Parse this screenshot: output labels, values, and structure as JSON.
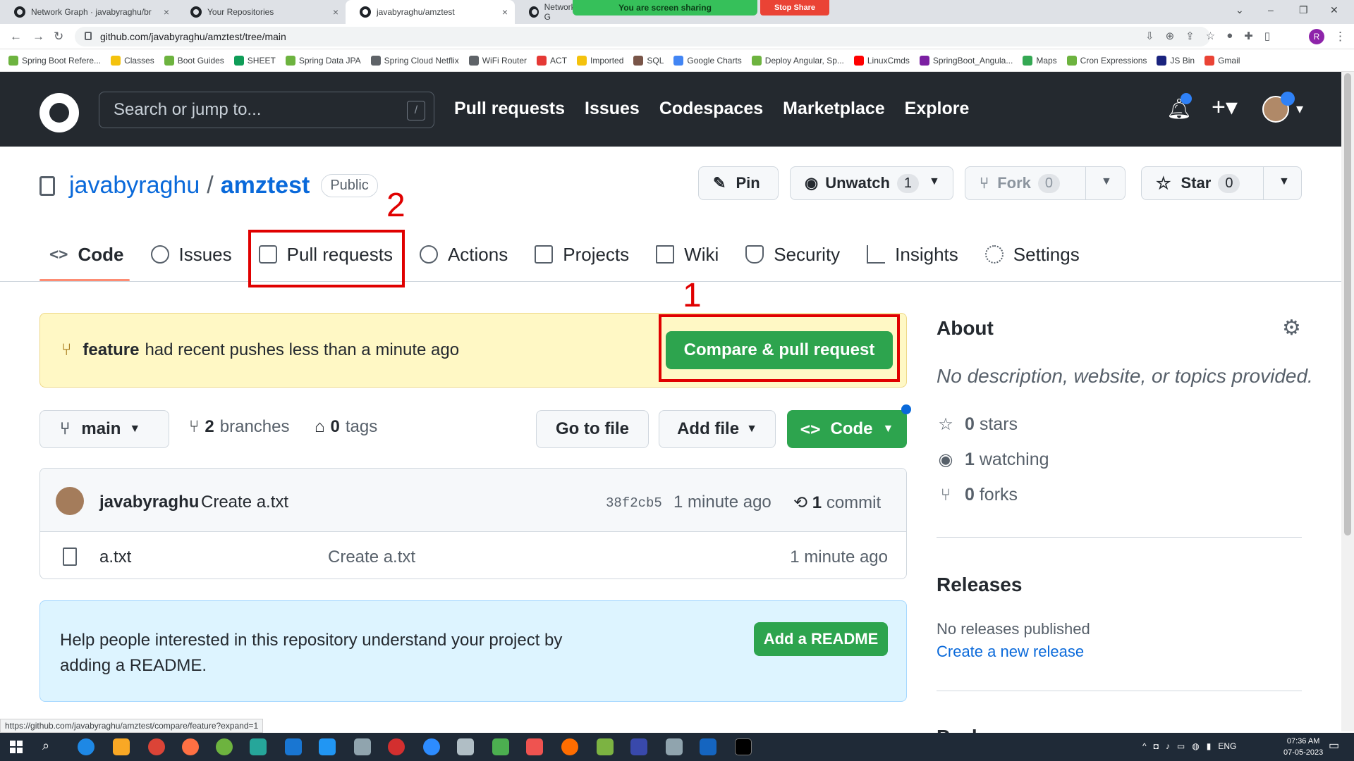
{
  "browser": {
    "tabs": [
      {
        "title": "Network Graph · javabyraghu/br",
        "close": "×"
      },
      {
        "title": "Your Repositories",
        "close": "×"
      },
      {
        "title": "javabyraghu/amztest",
        "close": "×"
      },
      {
        "title": "Network G",
        "close": ""
      }
    ],
    "share_text": "You are screen sharing",
    "stop_share": "Stop Share",
    "url": "github.com/javabyraghu/amztest/tree/main",
    "profile_initial": "R",
    "bookmarks": [
      "Spring Boot Refere...",
      "Classes",
      "Boot Guides",
      "SHEET",
      "Spring Data JPA",
      "Spring Cloud Netflix",
      "WiFi Router",
      "ACT",
      "Imported",
      "SQL",
      "Google Charts",
      "Deploy Angular, Sp...",
      "LinuxCmds",
      "SpringBoot_Angula...",
      "Maps",
      "Cron Expressions",
      "JS Bin",
      "Gmail"
    ],
    "status_url": "https://github.com/javabyraghu/amztest/compare/feature?expand=1"
  },
  "header": {
    "search_placeholder": "Search or jump to...",
    "slash": "/",
    "nav": [
      "Pull requests",
      "Issues",
      "Codespaces",
      "Marketplace",
      "Explore"
    ]
  },
  "repo": {
    "owner": "javabyraghu",
    "separator": "/",
    "name": "amztest",
    "visibility": "Public",
    "pin": "Pin",
    "unwatch": "Unwatch",
    "watch_count": "1",
    "fork": "Fork",
    "fork_count": "0",
    "star": "Star",
    "star_count": "0"
  },
  "tabs": [
    {
      "label": "Code"
    },
    {
      "label": "Issues"
    },
    {
      "label": "Pull requests"
    },
    {
      "label": "Actions"
    },
    {
      "label": "Projects"
    },
    {
      "label": "Wiki"
    },
    {
      "label": "Security"
    },
    {
      "label": "Insights"
    },
    {
      "label": "Settings"
    }
  ],
  "annotations": {
    "one": "1",
    "two": "2"
  },
  "banner": {
    "branch": "feature",
    "text": "had recent pushes less than a minute ago",
    "button": "Compare & pull request"
  },
  "filenav": {
    "branch": "main",
    "branches_count": "2",
    "branches_label": "branches",
    "tags_count": "0",
    "tags_label": "tags",
    "go_to_file": "Go to file",
    "add_file": "Add file",
    "code": "Code"
  },
  "commit": {
    "author": "javabyraghu",
    "message": "Create a.txt",
    "sha": "38f2cb5",
    "time": "1 minute ago",
    "count": "1",
    "count_label": "commit"
  },
  "files": [
    {
      "name": "a.txt",
      "message": "Create a.txt",
      "age": "1 minute ago"
    }
  ],
  "readme": {
    "text": "Help people interested in this repository understand your project by adding a README.",
    "button": "Add a README"
  },
  "about": {
    "title": "About",
    "description": "No description, website, or topics provided.",
    "stars_count": "0",
    "stars_label": "stars",
    "watching_count": "1",
    "watching_label": "watching",
    "forks_count": "0",
    "forks_label": "forks"
  },
  "releases": {
    "title": "Releases",
    "none": "No releases published",
    "link": "Create a new release"
  },
  "packages": {
    "title": "Packages"
  },
  "taskbar": {
    "lang": "ENG",
    "time": "07:36 AM",
    "date": "07-05-2023"
  },
  "colors": {
    "accent_green": "#2da44e",
    "link_blue": "#0969da",
    "header_dark": "#24292f",
    "annotation_red": "#e00000"
  }
}
